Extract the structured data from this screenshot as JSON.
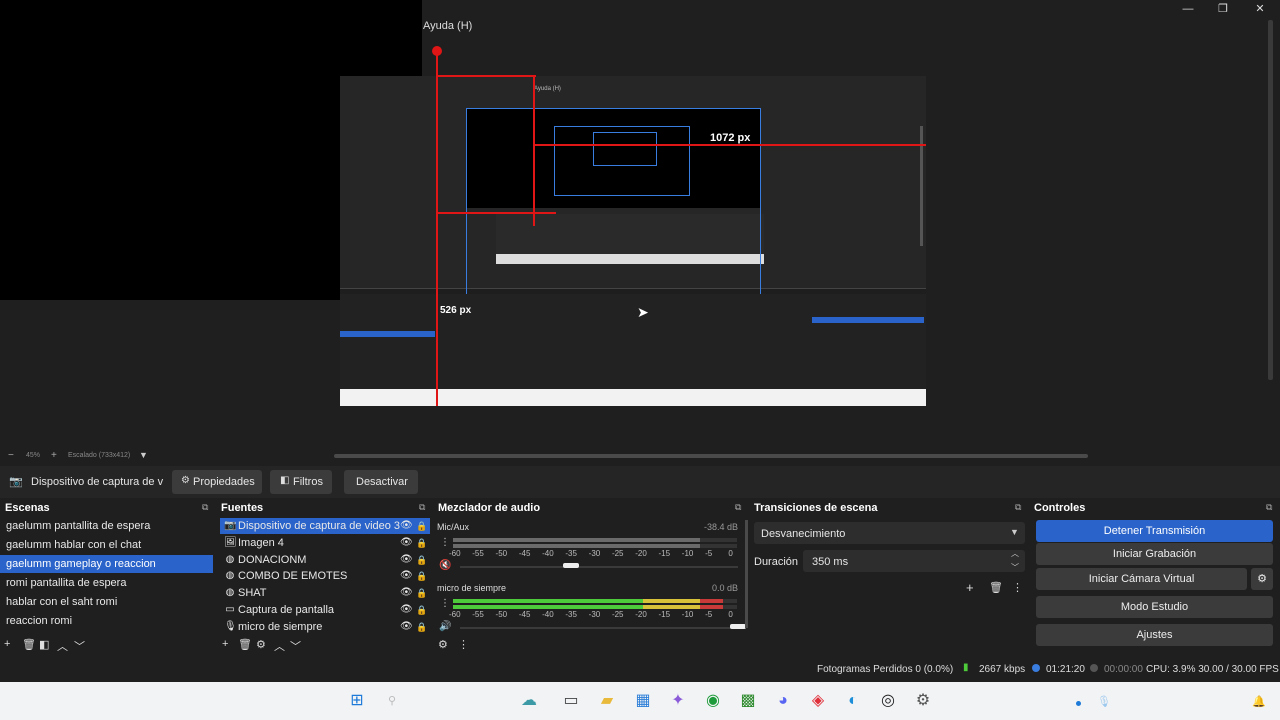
{
  "window": {
    "menu_help": "Ayuda (H)",
    "controls": [
      "—",
      "❐",
      "✕"
    ]
  },
  "preview": {
    "dim_label": "1072 px",
    "dim_label_small": "526 px",
    "inner_help": "Ayuda (H)",
    "zoom": "45%",
    "scale_label": "Escalado (733x412)"
  },
  "source_toolbar": {
    "source_name": "Dispositivo de captura de v",
    "properties": "Propiedades",
    "filters": "Filtros",
    "deactivate": "Desactivar"
  },
  "scenes": {
    "title": "Escenas",
    "items": [
      {
        "label": "gaelumm pantallita de espera",
        "selected": false
      },
      {
        "label": "gaelumm hablar con el chat",
        "selected": false
      },
      {
        "label": "gaelumm gameplay o reaccion",
        "selected": true
      },
      {
        "label": "romi pantallita de espera",
        "selected": false
      },
      {
        "label": "hablar con el saht romi",
        "selected": false
      },
      {
        "label": "reaccion romi",
        "selected": false
      }
    ]
  },
  "sources": {
    "title": "Fuentes",
    "items": [
      {
        "label": "Dispositivo de captura de video 3",
        "icon": "camera-icon",
        "selected": true
      },
      {
        "label": "Imagen 4",
        "icon": "image-icon",
        "selected": false
      },
      {
        "label": "DONACIONM",
        "icon": "browser-icon",
        "selected": false
      },
      {
        "label": "COMBO DE EMOTES",
        "icon": "browser-icon",
        "selected": false
      },
      {
        "label": "SHAT",
        "icon": "browser-icon",
        "selected": false
      },
      {
        "label": "Captura de pantalla",
        "icon": "monitor-icon",
        "selected": false
      },
      {
        "label": "micro de siempre",
        "icon": "microphone-icon",
        "selected": false
      }
    ]
  },
  "mixer": {
    "title": "Mezclador de audio",
    "channels": [
      {
        "name": "Mic/Aux",
        "db": "-38.4 dB",
        "level": 0.05,
        "muted": true,
        "fader": 0.38
      },
      {
        "name": "micro de siempre",
        "db": "0.0 dB",
        "level": 0.95,
        "muted": false,
        "fader": 1.0
      }
    ],
    "scale": [
      "-60",
      "-55",
      "-50",
      "-45",
      "-40",
      "-35",
      "-30",
      "-25",
      "-20",
      "-15",
      "-10",
      "-5",
      "0"
    ]
  },
  "transitions": {
    "title": "Transiciones de escena",
    "selected": "Desvanecimiento",
    "duration_label": "Duración",
    "duration_value": "350 ms"
  },
  "controls": {
    "title": "Controles",
    "stop_stream": "Detener Transmisión",
    "start_recording": "Iniciar Grabación",
    "start_virtual_cam": "Iniciar Cámara Virtual",
    "studio_mode": "Modo Estudio",
    "settings": "Ajustes"
  },
  "status": {
    "dropped": "Fotogramas Perdidos 0 (0.0%)",
    "bitrate": "2667 kbps",
    "live_time": "01:21:20",
    "rec_time": "00:00:00",
    "cpu": "CPU: 3.9% 30.00 / 30.00 FPS"
  },
  "colors": {
    "accent": "#2a63c9",
    "panel_bg": "#1f1f1f",
    "meter_green": "#4ecb3a",
    "meter_yellow": "#d8c23a",
    "meter_red": "#c83a3a",
    "guide_red": "#e01515"
  }
}
